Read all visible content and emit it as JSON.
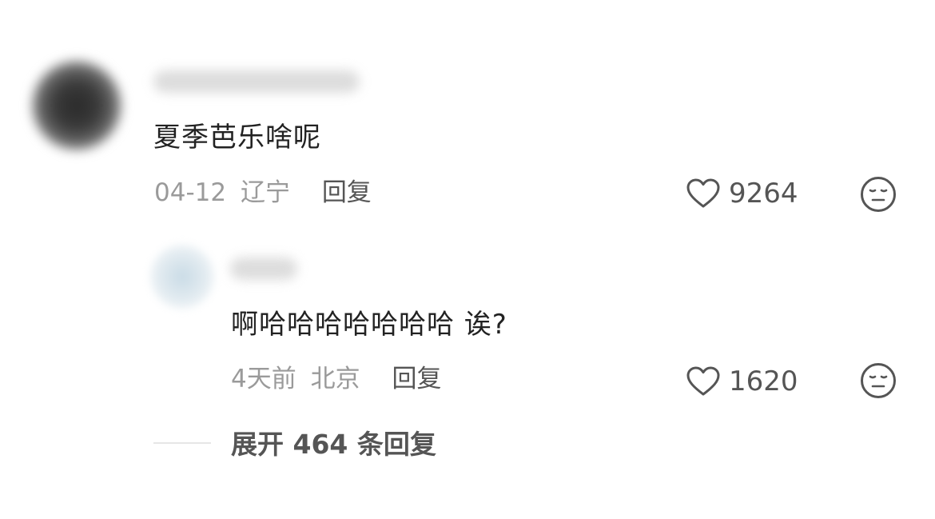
{
  "comment": {
    "text": "夏季芭乐啥呢",
    "date": "04-12",
    "location": "辽宁",
    "reply_label": "回复",
    "likes": "9264",
    "like_icon": "heart-outline-icon",
    "reaction_icon": "neutral-face-icon"
  },
  "reply": {
    "text": "啊哈哈哈哈哈哈哈 诶?",
    "date": "4天前",
    "location": "北京",
    "reply_label": "回复",
    "likes": "1620",
    "like_icon": "heart-outline-icon",
    "reaction_icon": "neutral-face-icon"
  },
  "expand": {
    "label": "展开 464 条回复"
  },
  "colors": {
    "primary_text": "#222222",
    "secondary_text": "#9a9a9a",
    "action_text": "#555555",
    "background": "#ffffff"
  }
}
